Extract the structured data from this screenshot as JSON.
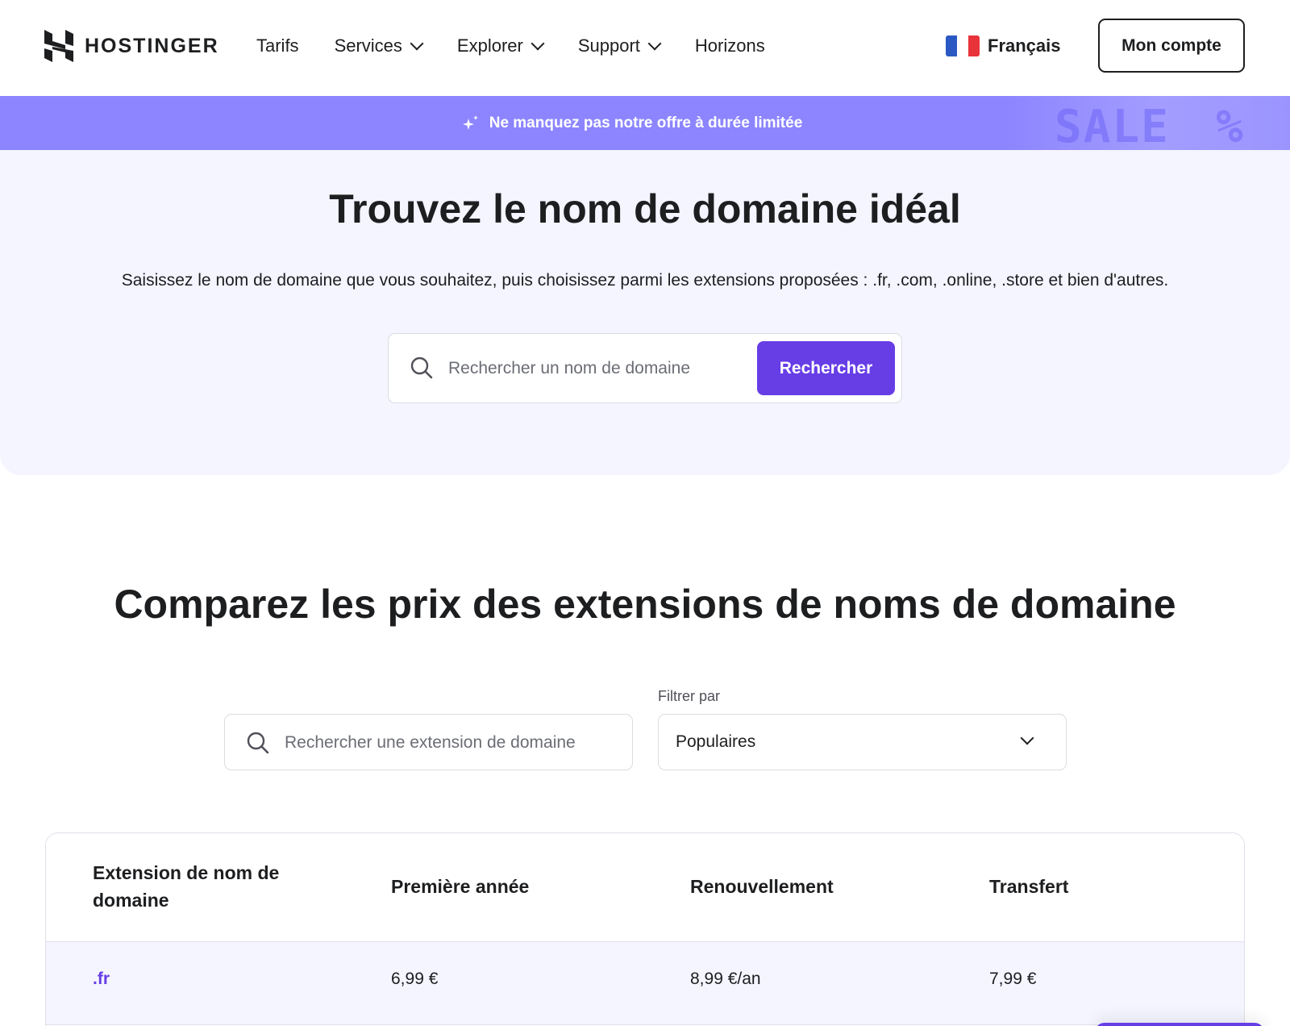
{
  "header": {
    "brand": "HOSTINGER",
    "nav": [
      {
        "label": "Tarifs",
        "dropdown": false
      },
      {
        "label": "Services",
        "dropdown": true
      },
      {
        "label": "Explorer",
        "dropdown": true
      },
      {
        "label": "Support",
        "dropdown": true
      },
      {
        "label": "Horizons",
        "dropdown": false
      }
    ],
    "language": "Français",
    "account_label": "Mon compte"
  },
  "promo": {
    "text": "Ne manquez pas notre offre à durée limitée",
    "deco_sale": "SALE",
    "deco_percent": "%"
  },
  "hero": {
    "title": "Trouvez le nom de domaine idéal",
    "subtitle": "Saisissez le nom de domaine que vous souhaitez, puis choisissez parmi les extensions proposées : .fr, .com, .online, .store et bien d'autres.",
    "search_placeholder": "Rechercher un nom de domaine",
    "search_button": "Rechercher"
  },
  "compare": {
    "title": "Comparez les prix des extensions de noms de domaine",
    "search_placeholder": "Rechercher une extension de domaine",
    "filter_label": "Filtrer par",
    "filter_value": "Populaires",
    "table": {
      "headers": [
        "Extension de nom de domaine",
        "Première année",
        "Renouvellement",
        "Transfert"
      ],
      "rows": [
        [
          ".fr",
          "6,99 €",
          "8,99 €/an",
          "7,99 €"
        ]
      ]
    }
  },
  "colors": {
    "primary": "#673de6",
    "promo_bg": "#8c85ff",
    "hero_bg": "#f4f5ff",
    "text": "#1d1e20"
  }
}
